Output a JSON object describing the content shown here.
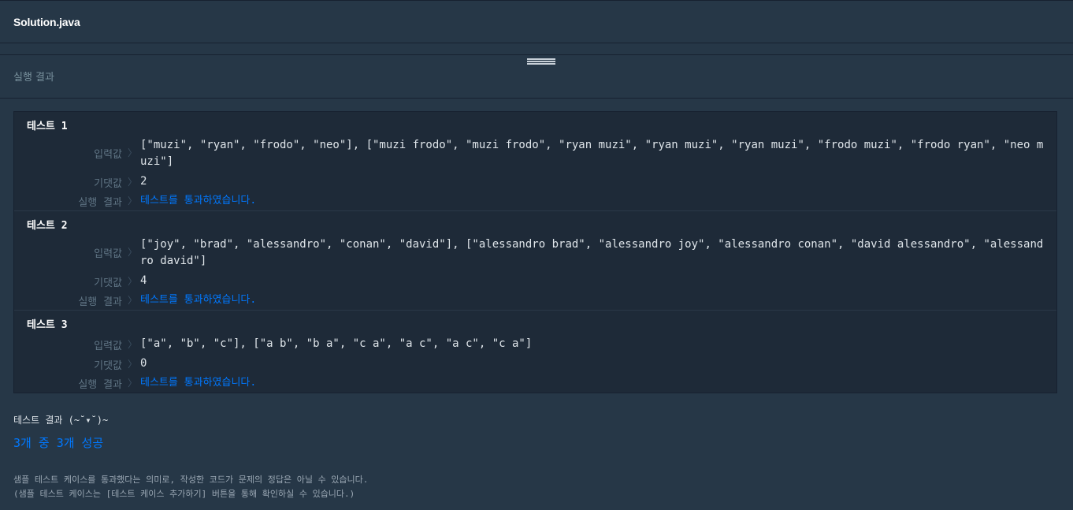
{
  "editor": {
    "file_name": "Solution.java"
  },
  "panel": {
    "title": "실행 결과"
  },
  "labels": {
    "input": "입력값",
    "expected": "기댓값",
    "result": "실행 결과",
    "separator": "〉"
  },
  "tests": [
    {
      "title": "테스트 1",
      "input": "[\"muzi\", \"ryan\", \"frodo\", \"neo\"], [\"muzi frodo\", \"muzi frodo\", \"ryan muzi\", \"ryan muzi\", \"ryan muzi\", \"frodo muzi\", \"frodo ryan\", \"neo muzi\"]",
      "expected": "2",
      "result": "테스트를 통과하였습니다."
    },
    {
      "title": "테스트 2",
      "input": "[\"joy\", \"brad\", \"alessandro\", \"conan\", \"david\"], [\"alessandro brad\", \"alessandro joy\", \"alessandro conan\", \"david alessandro\", \"alessandro david\"]",
      "expected": "4",
      "result": "테스트를 통과하였습니다."
    },
    {
      "title": "테스트 3",
      "input": "[\"a\", \"b\", \"c\"], [\"a b\", \"b a\", \"c a\", \"a c\", \"a c\", \"c a\"]",
      "expected": "0",
      "result": "테스트를 통과하였습니다."
    }
  ],
  "summary": {
    "label": "테스트 결과 (~˘▾˘)~",
    "value": "3개 중 3개 성공"
  },
  "notes": [
    "샘플 테스트 케이스를 통과했다는 의미로, 작성한 코드가 문제의 정답은 아닐 수 있습니다.",
    "(샘플 테스트 케이스는 [테스트 케이스 추가하기] 버튼을 통해 확인하실 수 있습니다.)"
  ],
  "colors": {
    "background": "#263747",
    "panel": "#1e2a38",
    "pass": "#0078ff",
    "text": "#dfe5ea",
    "muted": "#5f7484"
  }
}
